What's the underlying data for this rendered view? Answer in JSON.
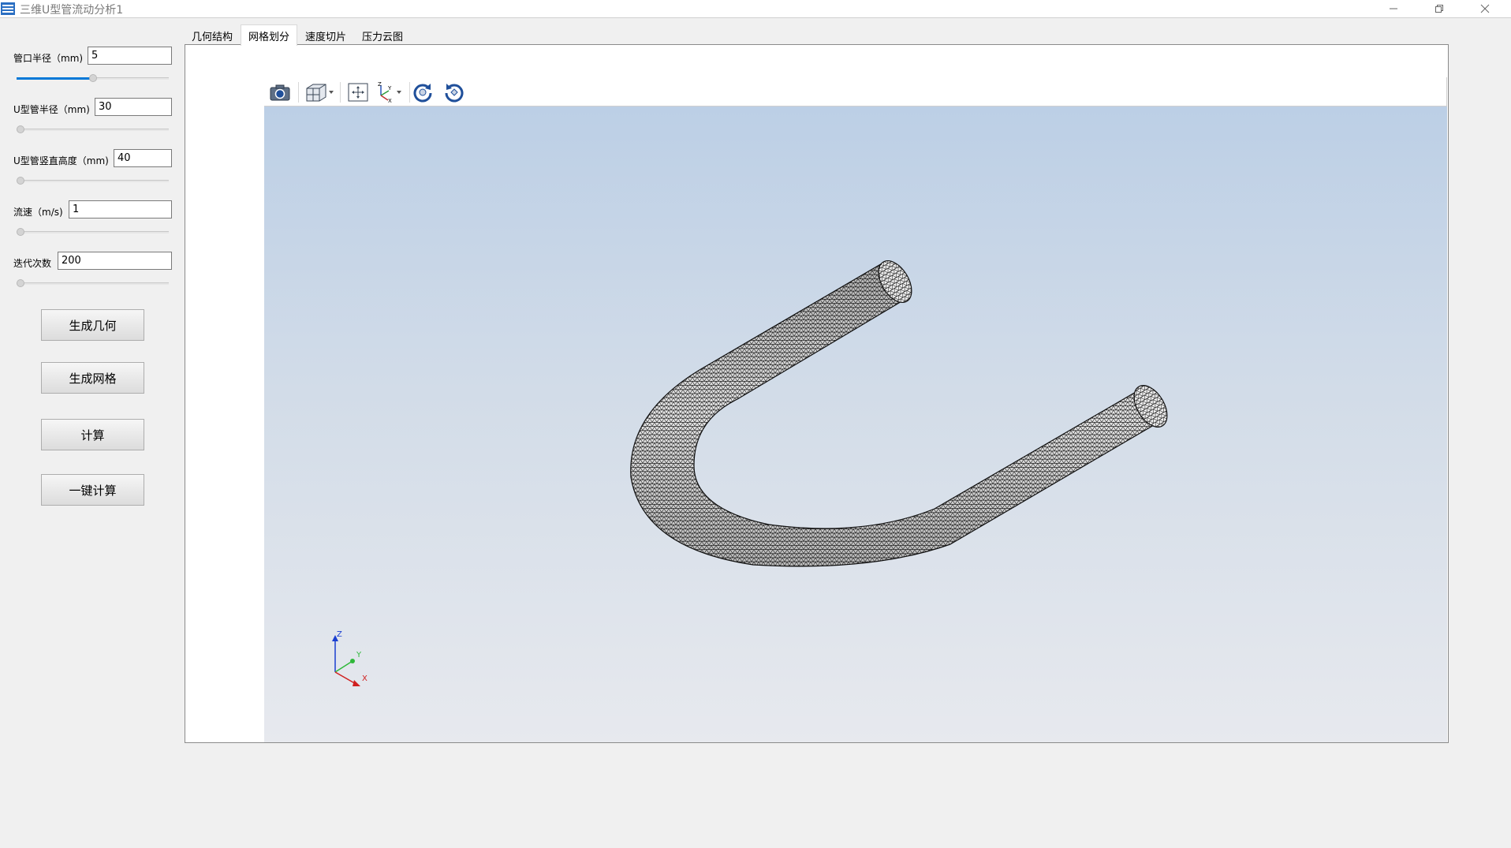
{
  "window": {
    "title": "三维U型管流动分析1",
    "controls": {
      "minimize": "minimize-icon",
      "restore": "restore-icon",
      "close": "close-icon"
    }
  },
  "params": [
    {
      "label": "管口半径（mm)",
      "value": "5",
      "slider_fraction": 0.5
    },
    {
      "label": "U型管半径（mm)",
      "value": "30",
      "slider_fraction": 0.0
    },
    {
      "label": "U型管竖直高度（mm)",
      "value": "40",
      "slider_fraction": 0.0
    },
    {
      "label": "流速（m/s)",
      "value": "1",
      "slider_fraction": 0.0
    },
    {
      "label": "迭代次数",
      "value": "200",
      "slider_fraction": 0.0
    }
  ],
  "buttons": {
    "generate_geometry": "生成几何",
    "generate_mesh": "生成网格",
    "compute": "计算",
    "one_click_compute": "一键计算"
  },
  "tabs": [
    {
      "label": "几何结构",
      "active": false
    },
    {
      "label": "网格划分",
      "active": true
    },
    {
      "label": "速度切片",
      "active": false
    },
    {
      "label": "压力云图",
      "active": false
    }
  ],
  "viewer": {
    "toolbar_icons": [
      "camera-icon",
      "view-cube-icon",
      "fit-view-icon",
      "axes-icon",
      "rotate-cw-icon",
      "rotate-ccw-icon"
    ],
    "axis_labels": {
      "x": "X",
      "y": "Y",
      "z": "Z"
    },
    "background_top": "#bccfe6",
    "background_bottom": "#e7e9ee",
    "accent": "#0078d7"
  }
}
